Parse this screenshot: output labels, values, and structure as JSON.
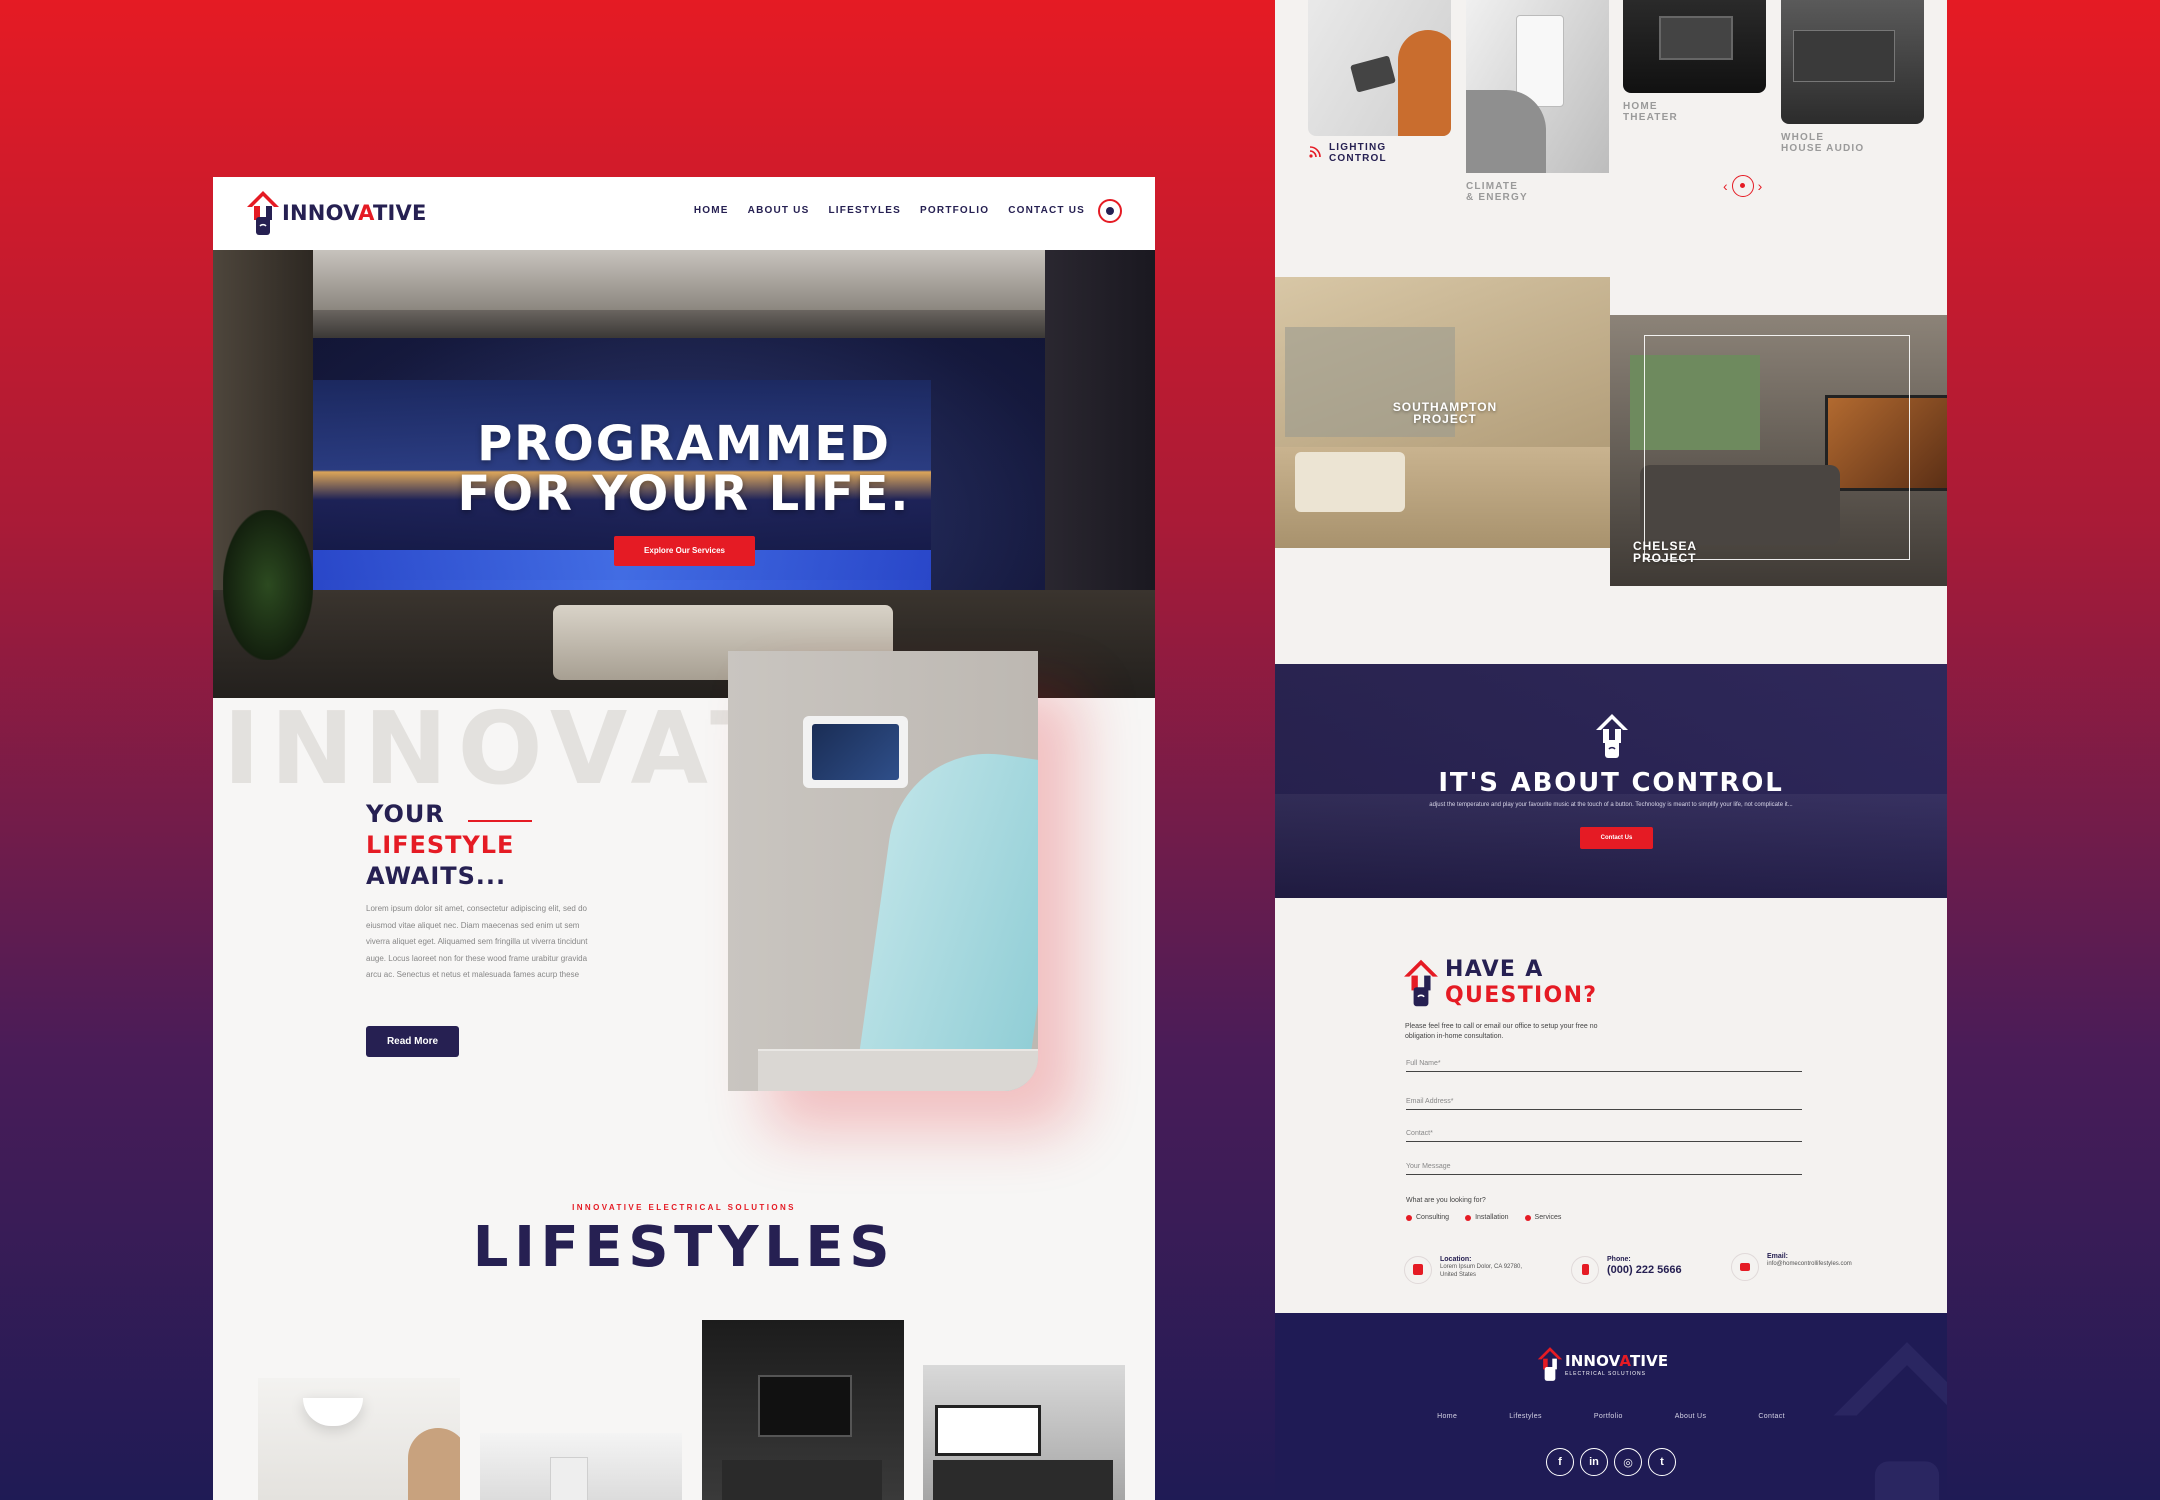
{
  "colors": {
    "brand_red": "#e51b24",
    "brand_navy": "#262052",
    "page_bg": "#f7f6f5"
  },
  "logo": {
    "text_navy": "INNOV",
    "text_red": "A",
    "text_navy_2": "TIVE",
    "tagline": "ELECTRICAL SOLUTIONS",
    "icon": "house-logo-icon"
  },
  "nav": {
    "items": [
      "HOME",
      "ABOUT US",
      "LIFESTYLES",
      "PORTFOLIO",
      "CONTACT US"
    ],
    "menu_icon": "circle-menu-icon"
  },
  "hero": {
    "title_line1": "PROGRAMMED",
    "title_line2": "FOR YOUR LIFE.",
    "cta": "Explore Our Services"
  },
  "watermark": "INNOVATIVE",
  "lifestyle": {
    "line1": "YOUR",
    "line2": "LIFESTYLE",
    "line3": "AWAITS...",
    "body": "Lorem ipsum dolor sit amet, consectetur adipiscing elit, sed do eiusmod vitae aliquet nec. Diam maecenas sed enim ut sem viverra aliquet eget. Aliquamed sem fringilla ut viverra tincidunt auge. Locus laoreet non for these wood frame urabitur gravida arcu ac. Senectus et netus et malesuada fames acurp these",
    "cta": "Read More"
  },
  "lifestyles_section": {
    "subtitle": "INNOVATIVE ELECTRICAL SOLUTIONS",
    "title": "LIFESTYLES"
  },
  "services": {
    "items": [
      {
        "line1": "LIGHTING",
        "line2": "CONTROL",
        "icon": "rss-icon"
      },
      {
        "line1": "CLIMATE",
        "line2": "& ENERGY"
      },
      {
        "line1": "HOME",
        "line2": "THEATER"
      },
      {
        "line1": "WHOLE",
        "line2": "HOUSE AUDIO"
      }
    ],
    "prev_icon": "chevron-left-icon",
    "next_icon": "chevron-right-icon"
  },
  "projects": [
    {
      "line1": "SOUTHAMPTON",
      "line2": "PROJECT"
    },
    {
      "line1": "CHELSEA",
      "line2": "PROJECT"
    }
  ],
  "control": {
    "title": "IT'S ABOUT CONTROL",
    "desc": "adjust the temperature and play your favourite music at the touch of a button. Technology is meant to simplify your life, not complicate it...",
    "cta": "Contact Us"
  },
  "question": {
    "line1": "HAVE A",
    "line2": "QUESTION?",
    "desc": "Please feel free to call or email our office to setup your free no obligation in-home consultation.",
    "fields": [
      "Full Name*",
      "Email Address*",
      "Contact*",
      "Your Message"
    ],
    "looking_for": "What are you looking for?",
    "options": [
      "Consulting",
      "Installation",
      "Services"
    ]
  },
  "contact": {
    "location": {
      "label": "Location:",
      "value_line1": "Lorem Ipsum Dolor, CA 92780,",
      "value_line2": "United States",
      "icon": "map-pin-icon"
    },
    "phone": {
      "label": "Phone:",
      "value": "(000) 222 5666",
      "icon": "phone-icon"
    },
    "email": {
      "label": "Email:",
      "value": "info@homecontrollifestyles.com",
      "icon": "envelope-icon"
    }
  },
  "footer": {
    "nav": [
      "Home",
      "Lifestyles",
      "Portfolio",
      "About Us",
      "Contact"
    ],
    "socials": [
      {
        "label": "f",
        "icon": "facebook-icon"
      },
      {
        "label": "in",
        "icon": "linkedin-icon"
      },
      {
        "label": "◎",
        "icon": "instagram-icon"
      },
      {
        "label": "t",
        "icon": "twitter-icon"
      }
    ]
  }
}
